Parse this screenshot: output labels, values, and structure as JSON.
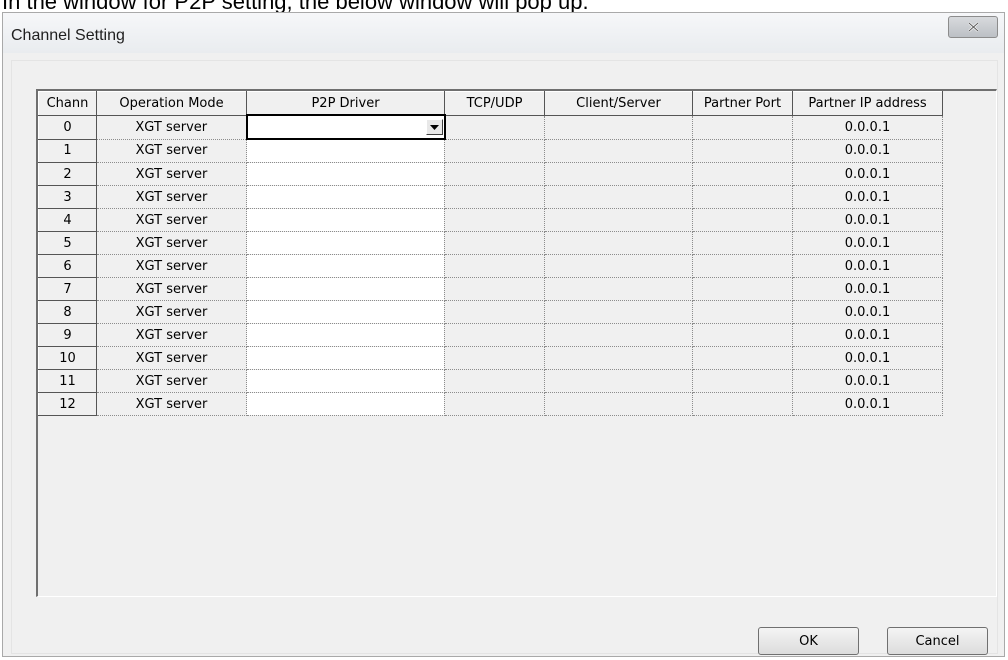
{
  "doc_caption": "In the window for P2P setting, the below window will pop up.",
  "window": {
    "title": "Channel Setting",
    "close_glyph": "X"
  },
  "grid": {
    "columns": [
      "Chann",
      "Operation Mode",
      "P2P Driver",
      "TCP/UDP",
      "Client/Server",
      "Partner Port",
      "Partner IP address"
    ],
    "rows": [
      {
        "channel": "0",
        "mode": "XGT server",
        "driver": "",
        "tcp_udp": "",
        "client_server": "",
        "partner_port": "",
        "partner_ip": "0.0.0.1"
      },
      {
        "channel": "1",
        "mode": "XGT server",
        "driver": "",
        "tcp_udp": "",
        "client_server": "",
        "partner_port": "",
        "partner_ip": "0.0.0.1"
      },
      {
        "channel": "2",
        "mode": "XGT server",
        "driver": "",
        "tcp_udp": "",
        "client_server": "",
        "partner_port": "",
        "partner_ip": "0.0.0.1"
      },
      {
        "channel": "3",
        "mode": "XGT server",
        "driver": "",
        "tcp_udp": "",
        "client_server": "",
        "partner_port": "",
        "partner_ip": "0.0.0.1"
      },
      {
        "channel": "4",
        "mode": "XGT server",
        "driver": "",
        "tcp_udp": "",
        "client_server": "",
        "partner_port": "",
        "partner_ip": "0.0.0.1"
      },
      {
        "channel": "5",
        "mode": "XGT server",
        "driver": "",
        "tcp_udp": "",
        "client_server": "",
        "partner_port": "",
        "partner_ip": "0.0.0.1"
      },
      {
        "channel": "6",
        "mode": "XGT server",
        "driver": "",
        "tcp_udp": "",
        "client_server": "",
        "partner_port": "",
        "partner_ip": "0.0.0.1"
      },
      {
        "channel": "7",
        "mode": "XGT server",
        "driver": "",
        "tcp_udp": "",
        "client_server": "",
        "partner_port": "",
        "partner_ip": "0.0.0.1"
      },
      {
        "channel": "8",
        "mode": "XGT server",
        "driver": "",
        "tcp_udp": "",
        "client_server": "",
        "partner_port": "",
        "partner_ip": "0.0.0.1"
      },
      {
        "channel": "9",
        "mode": "XGT server",
        "driver": "",
        "tcp_udp": "",
        "client_server": "",
        "partner_port": "",
        "partner_ip": "0.0.0.1"
      },
      {
        "channel": "10",
        "mode": "XGT server",
        "driver": "",
        "tcp_udp": "",
        "client_server": "",
        "partner_port": "",
        "partner_ip": "0.0.0.1"
      },
      {
        "channel": "11",
        "mode": "XGT server",
        "driver": "",
        "tcp_udp": "",
        "client_server": "",
        "partner_port": "",
        "partner_ip": "0.0.0.1"
      },
      {
        "channel": "12",
        "mode": "XGT server",
        "driver": "",
        "tcp_udp": "",
        "client_server": "",
        "partner_port": "",
        "partner_ip": "0.0.0.1"
      }
    ]
  },
  "buttons": {
    "ok": "OK",
    "cancel": "Cancel"
  },
  "icons": {
    "close": "close-icon",
    "dropdown": "chevron-down-icon"
  }
}
